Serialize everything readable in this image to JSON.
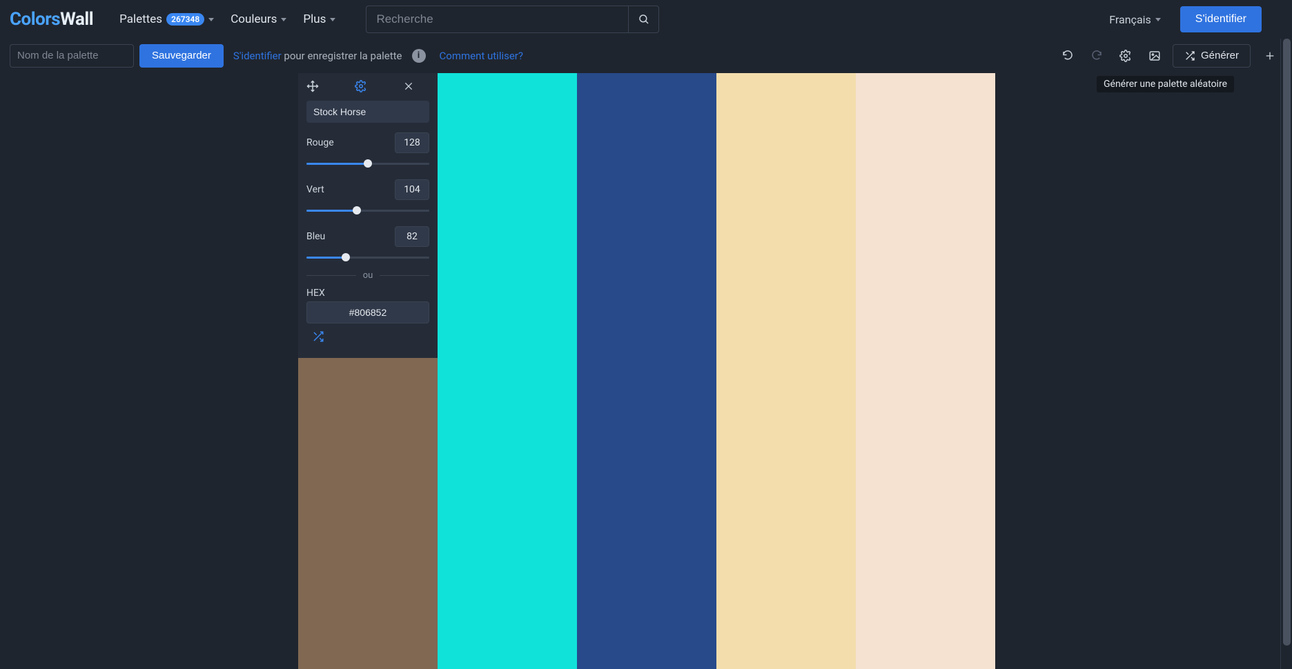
{
  "header": {
    "logo_part1": "Colors",
    "logo_part2": "Wall",
    "nav": {
      "palettes": "Palettes",
      "palettes_count": "267348",
      "couleurs": "Couleurs",
      "plus": "Plus"
    },
    "search_placeholder": "Recherche",
    "language": "Français",
    "signin": "S'identifier"
  },
  "toolbar": {
    "palette_name_placeholder": "Nom de la palette",
    "save": "Sauvegarder",
    "hint_link": "S'identifier",
    "hint_rest": " pour enregistrer la palette",
    "howto": "Comment utiliser?",
    "generate": "Générer",
    "tooltip": "Générer une palette aléatoire"
  },
  "edit_panel": {
    "color_name": "Stock Horse",
    "rgb": {
      "r_label": "Rouge",
      "r_value": "128",
      "g_label": "Vert",
      "g_value": "104",
      "b_label": "Bleu",
      "b_value": "82"
    },
    "or": "ou",
    "hex_label": "HEX",
    "hex_value": "#806852"
  },
  "palette": {
    "colors": [
      "#806852",
      "#10e2da",
      "#284a8a",
      "#f3ddad",
      "#f5e2d0"
    ]
  }
}
